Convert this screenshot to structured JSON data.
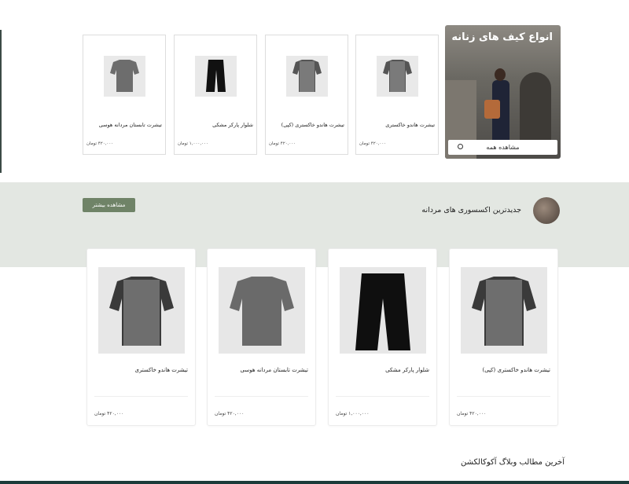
{
  "featured": {
    "title": "انواع کیف های زنانه",
    "view_all_label": "مشاهده همه"
  },
  "top_products": [
    {
      "name": "تیشرت هاندو خاکستری",
      "price": "۴۲۰,۰۰۰ تومان"
    },
    {
      "name": "تیشرت هاندو خاکستری (کپی)",
      "price": "۴۲۰,۰۰۰ تومان"
    },
    {
      "name": "شلوار پارکر مشکی",
      "price": "۱,۰۰۰,۰۰۰ تومان"
    },
    {
      "name": "تیشرت تابستان مردانه هوسی",
      "price": "۴۲۰,۰۰۰ تومان"
    }
  ],
  "accessories": {
    "title": "جدیدترین اکسسوری های مردانه",
    "more_label": "مشاهده بیشتر"
  },
  "accessory_products": [
    {
      "name": "تیشرت هاندو خاکستری (کپی)",
      "price": "۴۲۰,۰۰۰ تومان"
    },
    {
      "name": "شلوار پارکر مشکی",
      "price": "۱,۰۰۰,۰۰۰ تومان"
    },
    {
      "name": "تیشرت تابستان مردانه هوسی",
      "price": "۴۲۰,۰۰۰ تومان"
    },
    {
      "name": "تیشرت هاندو خاکستری",
      "price": "۴۲۰,۰۰۰ تومان"
    }
  ],
  "blog": {
    "title": "آخرین مطالب وبلاگ آکوکالکشن"
  },
  "colors": {
    "band_bg": "#e3e7e2",
    "accent_button": "#6f8367",
    "footer": "#1b3b3a"
  }
}
